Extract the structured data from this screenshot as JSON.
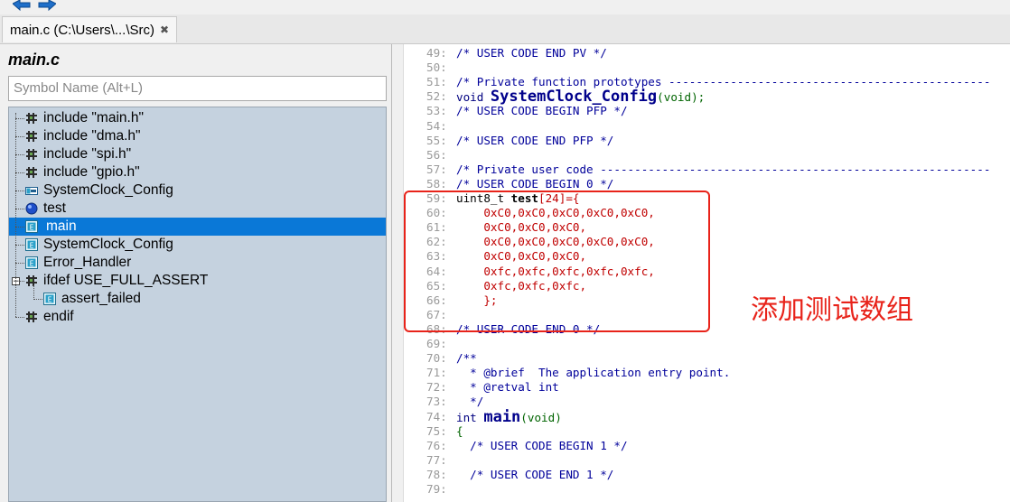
{
  "toolbar": {
    "back_icon": "back-arrow-icon",
    "forward_icon": "forward-arrow-icon"
  },
  "tab": {
    "label": "main.c (C:\\Users\\...\\Src)",
    "close_glyph": "✖"
  },
  "outline": {
    "file_title": "main.c",
    "search_placeholder": "Symbol Name (Alt+L)",
    "items": [
      {
        "label": "include \"main.h\"",
        "icon": "include-icon"
      },
      {
        "label": "include \"dma.h\"",
        "icon": "include-icon"
      },
      {
        "label": "include \"spi.h\"",
        "icon": "include-icon"
      },
      {
        "label": "include \"gpio.h\"",
        "icon": "include-icon"
      },
      {
        "label": "SystemClock_Config",
        "icon": "function-prototype-icon"
      },
      {
        "label": "test",
        "icon": "variable-icon"
      },
      {
        "label": "main",
        "icon": "function-icon",
        "selected": true
      },
      {
        "label": "SystemClock_Config",
        "icon": "function-icon"
      },
      {
        "label": "Error_Handler",
        "icon": "function-icon"
      },
      {
        "label": "ifdef USE_FULL_ASSERT",
        "icon": "ifdef-icon",
        "expander": "−"
      },
      {
        "label": "assert_failed",
        "icon": "function-icon"
      },
      {
        "label": "endif",
        "icon": "include-icon"
      }
    ]
  },
  "editor": {
    "lines": [
      {
        "num": "49:",
        "parts": [
          [
            "cm",
            "/* USER CODE END PV */"
          ]
        ]
      },
      {
        "num": "50:",
        "parts": []
      },
      {
        "num": "51:",
        "parts": [
          [
            "cm",
            "/* Private function prototypes -----------------------------------------------"
          ]
        ]
      },
      {
        "num": "52:",
        "parts": [
          [
            "kw",
            "void "
          ],
          [
            "fn",
            "SystemClock_Config"
          ],
          [
            "par",
            "(void);"
          ]
        ]
      },
      {
        "num": "53:",
        "parts": [
          [
            "cm",
            "/* USER CODE BEGIN PFP */"
          ]
        ]
      },
      {
        "num": "54:",
        "parts": []
      },
      {
        "num": "55:",
        "parts": [
          [
            "cm",
            "/* USER CODE END PFP */"
          ]
        ]
      },
      {
        "num": "56:",
        "parts": []
      },
      {
        "num": "57:",
        "parts": [
          [
            "cm",
            "/* Private user code ---------------------------------------------------------"
          ]
        ]
      },
      {
        "num": "58:",
        "parts": [
          [
            "cm",
            "/* USER CODE BEGIN 0 */"
          ]
        ]
      },
      {
        "num": "59:",
        "parts": [
          [
            "pl",
            "uint8_t "
          ],
          [
            "fnsm",
            "test"
          ],
          [
            "hex",
            "[24]={"
          ]
        ]
      },
      {
        "num": "60:",
        "parts": [
          [
            "hex",
            "    0xC0,0xC0,0xC0,0xC0,0xC0,"
          ]
        ]
      },
      {
        "num": "61:",
        "parts": [
          [
            "hex",
            "    0xC0,0xC0,0xC0,"
          ]
        ]
      },
      {
        "num": "62:",
        "parts": [
          [
            "hex",
            "    0xC0,0xC0,0xC0,0xC0,0xC0,"
          ]
        ]
      },
      {
        "num": "63:",
        "parts": [
          [
            "hex",
            "    0xC0,0xC0,0xC0,"
          ]
        ]
      },
      {
        "num": "64:",
        "parts": [
          [
            "hex",
            "    0xfc,0xfc,0xfc,0xfc,0xfc,"
          ]
        ]
      },
      {
        "num": "65:",
        "parts": [
          [
            "hex",
            "    0xfc,0xfc,0xfc,"
          ]
        ]
      },
      {
        "num": "66:",
        "parts": [
          [
            "hex",
            "    };"
          ]
        ]
      },
      {
        "num": "67:",
        "parts": []
      },
      {
        "num": "68:",
        "parts": [
          [
            "cm",
            "/* USER CODE END 0 */"
          ]
        ]
      },
      {
        "num": "69:",
        "parts": []
      },
      {
        "num": "70:",
        "parts": [
          [
            "cm",
            "/**"
          ]
        ]
      },
      {
        "num": "71:",
        "parts": [
          [
            "cm",
            "  * @brief  The application entry point."
          ]
        ]
      },
      {
        "num": "72:",
        "parts": [
          [
            "cm",
            "  * @retval int"
          ]
        ]
      },
      {
        "num": "73:",
        "parts": [
          [
            "cm",
            "  */"
          ]
        ]
      },
      {
        "num": "74:",
        "parts": [
          [
            "kw",
            "int "
          ],
          [
            "fn",
            "main"
          ],
          [
            "par",
            "(void)"
          ]
        ]
      },
      {
        "num": "75:",
        "parts": [
          [
            "par",
            "{"
          ]
        ]
      },
      {
        "num": "76:",
        "parts": [
          [
            "cm",
            "  /* USER CODE BEGIN 1 */"
          ]
        ]
      },
      {
        "num": "77:",
        "parts": []
      },
      {
        "num": "78:",
        "parts": [
          [
            "cm",
            "  /* USER CODE END 1 */"
          ]
        ]
      },
      {
        "num": "79:",
        "parts": []
      }
    ]
  },
  "annotation": {
    "text": "添加测试数组",
    "color": "#e8231a"
  }
}
